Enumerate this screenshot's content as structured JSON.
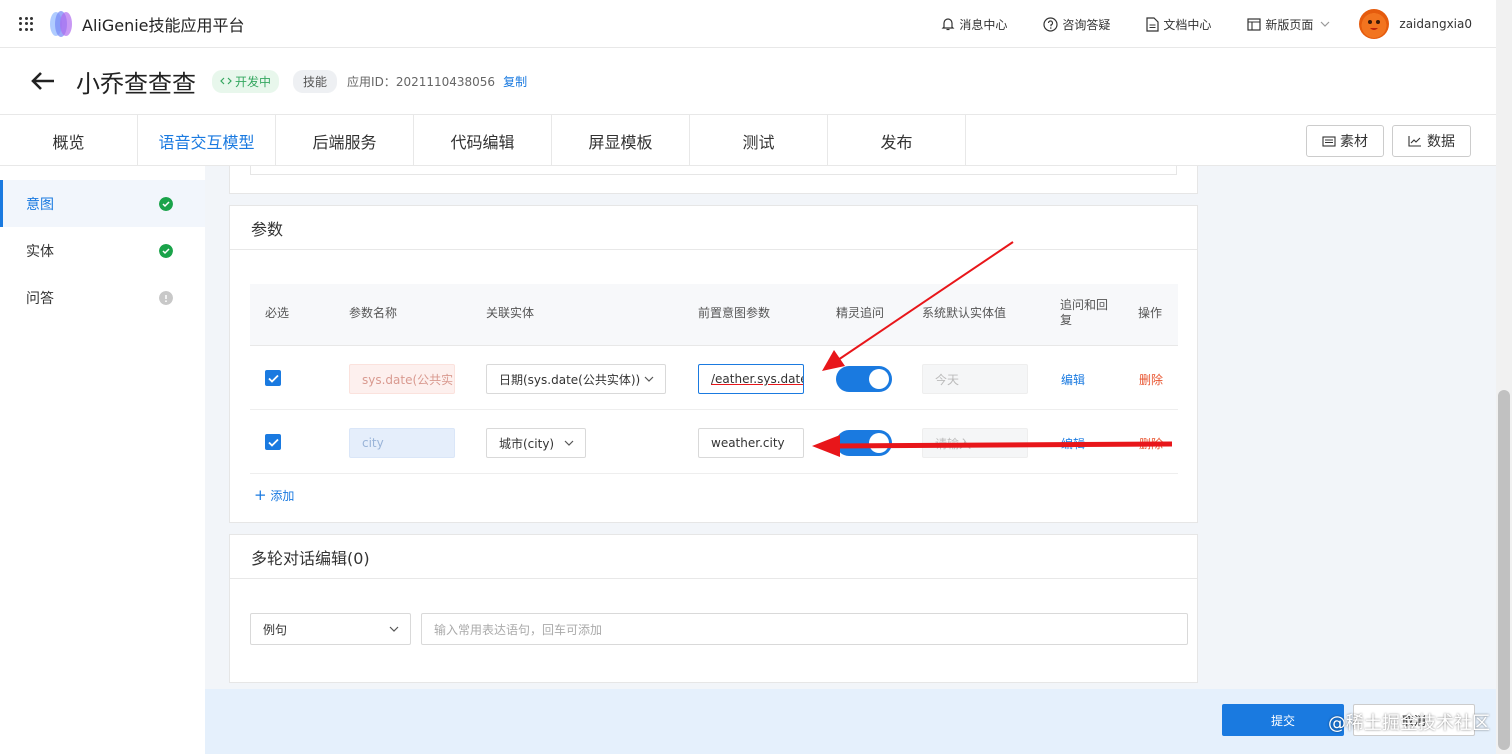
{
  "app": {
    "title": "AliGenie技能应用平台"
  },
  "top_nav": {
    "messages": "消息中心",
    "consult": "咨询答疑",
    "docs": "文档中心",
    "new_page": "新版页面",
    "username": "zaidangxia0"
  },
  "header": {
    "title": "小乔查查查",
    "status_tag": "开发中",
    "type_tag": "技能",
    "app_id_label": "应用ID：",
    "app_id": "2021110438056",
    "copy_label": "复制"
  },
  "tabs": [
    {
      "label": "概览"
    },
    {
      "label": "语音交互模型"
    },
    {
      "label": "后端服务"
    },
    {
      "label": "代码编辑"
    },
    {
      "label": "屏显模板"
    },
    {
      "label": "测试"
    },
    {
      "label": "发布"
    }
  ],
  "actions": {
    "material": "素材",
    "data": "数据"
  },
  "sidebar": {
    "items": [
      {
        "label": "意图"
      },
      {
        "label": "实体"
      },
      {
        "label": "问答"
      }
    ]
  },
  "params": {
    "title": "参数",
    "headers": {
      "required": "必选",
      "name": "参数名称",
      "entity": "关联实体",
      "prev_intent": "前置意图参数",
      "follow_up": "精灵追问",
      "default_value": "系统默认实体值",
      "reply": "追问和回复",
      "ops": "操作"
    },
    "rows": [
      {
        "name": "sys.date(公共实",
        "entity": "日期(sys.date(公共实体))",
        "prev_intent": "/eather.sys.date",
        "default_value": "今天",
        "edit": "编辑",
        "delete": "删除"
      },
      {
        "name": "city",
        "entity": "城市(city)",
        "prev_intent": "weather.city",
        "default_value": "请输入",
        "edit": "编辑",
        "delete": "删除"
      }
    ],
    "add_label": "添加"
  },
  "multi_turn": {
    "title": "多轮对话编辑(0)",
    "select_value": "例句",
    "input_placeholder": "输入常用表达语句，回车可添加"
  },
  "footer": {
    "submit": "提交",
    "cancel": "取消"
  },
  "watermark": "@稀土掘金技术社区",
  "colors": {
    "primary": "#1a7ae0",
    "danger": "#e8542f",
    "success": "#35a760",
    "arrow": "#e8161a"
  }
}
